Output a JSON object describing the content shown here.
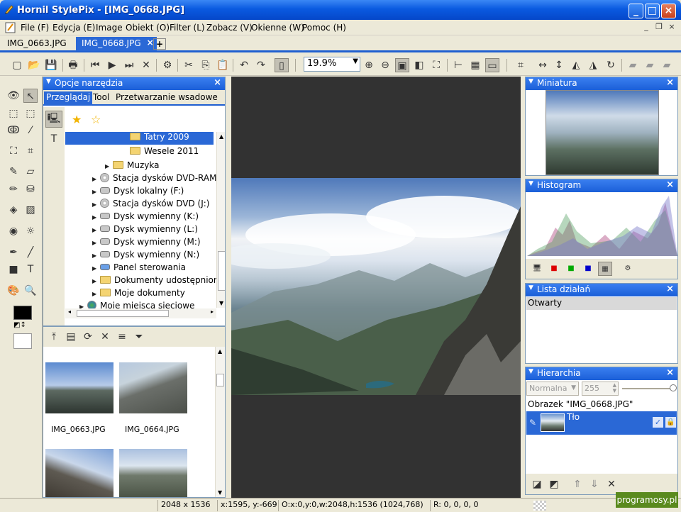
{
  "window": {
    "title": "Hornil StylePix - [IMG_0668.JPG]"
  },
  "menu": [
    "File (F)",
    "Edycja (E)",
    "Image",
    "Obiekt (O)",
    "Filter (L)",
    "Zobacz (V)",
    "Okienne (W)",
    "Pomoc (H)"
  ],
  "tabs": [
    {
      "label": "IMG_0663.JPG"
    },
    {
      "label": "IMG_0668.JPG"
    }
  ],
  "toolbar": {
    "zoom": "19.9%"
  },
  "tool_options": {
    "title": "Opcje narzędzia",
    "tabs": [
      "Przeglądaj",
      "Tool",
      "Przetwarzanie wsadowe"
    ],
    "tree": [
      {
        "label": "Tatry 2009",
        "icon": "folder",
        "selected": true
      },
      {
        "label": "Wesele 2011",
        "icon": "folder"
      },
      {
        "label": "Muzyka",
        "icon": "folder"
      },
      {
        "label": "Stacja dysków DVD-RAM (",
        "icon": "cd"
      },
      {
        "label": "Dysk lokalny (F:)",
        "icon": "drive"
      },
      {
        "label": "Stacja dysków DVD (J:)",
        "icon": "cd"
      },
      {
        "label": "Dysk wymienny (K:)",
        "icon": "drive"
      },
      {
        "label": "Dysk wymienny (L:)",
        "icon": "drive"
      },
      {
        "label": "Dysk wymienny (M:)",
        "icon": "drive"
      },
      {
        "label": "Dysk wymienny (N:)",
        "icon": "drive"
      },
      {
        "label": "Panel sterowania",
        "icon": "control-panel"
      },
      {
        "label": "Dokumenty udostępnione",
        "icon": "folder"
      },
      {
        "label": "Moje dokumenty",
        "icon": "folder"
      },
      {
        "label": "Moje miejsca sieciowe",
        "icon": "network"
      }
    ],
    "thumbnails": [
      {
        "label": "IMG_0663.JPG"
      },
      {
        "label": "IMG_0664.JPG"
      },
      {
        "label": ""
      },
      {
        "label": ""
      }
    ]
  },
  "panels": {
    "miniatura": {
      "title": "Miniatura"
    },
    "histogram": {
      "title": "Histogram"
    },
    "history": {
      "title": "Lista działań",
      "items": [
        "Otwarty"
      ]
    },
    "hierarchy": {
      "title": "Hierarchia",
      "blend_mode": "Normalna",
      "opacity": "255",
      "image_label": "Obrazek \"IMG_0668.JPG\"",
      "layer_name": "Tło"
    }
  },
  "status": {
    "size": "2048 x 1536",
    "cursor": "x:1595, y:-669",
    "selection": "O:x:0,y:0,w:2048,h:1536 (1024,768)",
    "color": "R: 0, 0, 0, 0"
  },
  "watermark": "programosy.pl",
  "colors": {
    "accent": "#2a68d6",
    "titlebar": "#0a5ae0",
    "canvas_bg": "#323232",
    "foreground": "#000000",
    "background": "#ffffff"
  }
}
